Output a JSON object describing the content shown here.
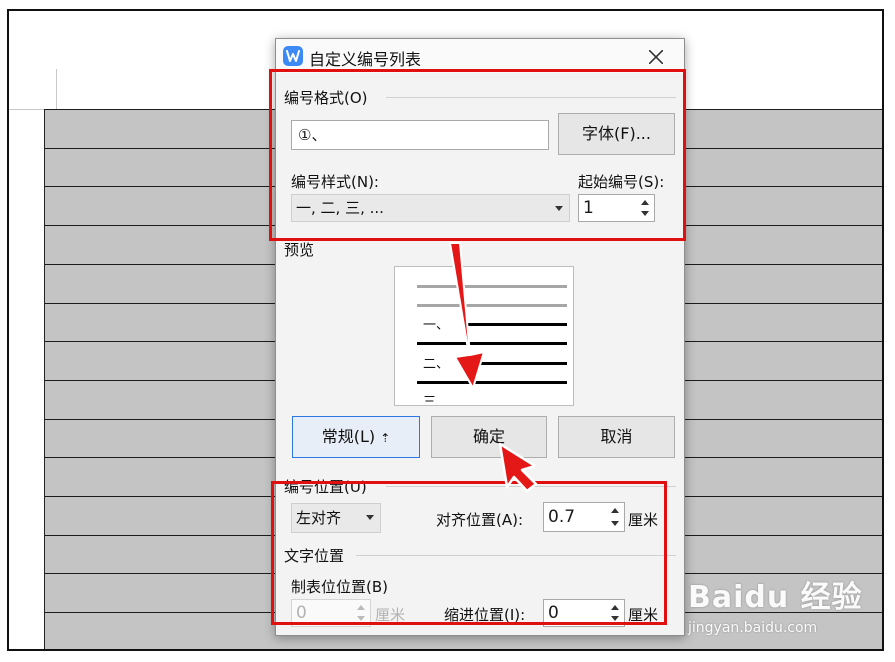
{
  "dialog": {
    "title": "自定义编号列表",
    "number_format": {
      "group_label": "编号格式(O)",
      "format_value": "①、",
      "font_button": "字体(F)...",
      "style_label": "编号样式(N):",
      "style_value": "一, 二, 三, ...",
      "start_label": "起始编号(S):",
      "start_value": "1"
    },
    "preview": {
      "label": "预览",
      "items": [
        "一、",
        "二、",
        "三"
      ]
    },
    "buttons": {
      "normal": "常规(L)",
      "normal_marker": "⇡",
      "ok": "确定",
      "cancel": "取消"
    },
    "number_position": {
      "group_label": "编号位置(U)",
      "align_value": "左对齐",
      "align_pos_label": "对齐位置(A):",
      "align_pos_value": "0.7",
      "unit": "厘米"
    },
    "text_position": {
      "group_label": "文字位置",
      "tab_label": "制表位位置(B)",
      "tab_value": "0",
      "tab_unit": "厘米",
      "indent_label": "缩进位置(I):",
      "indent_value": "0",
      "indent_unit": "厘米"
    }
  },
  "watermark": {
    "brand": "Baidu 经验",
    "url": "jingyan.baidu.com"
  },
  "colors": {
    "highlight_red": "#e01010",
    "app_icon_blue": "#3d8af7",
    "table_gray": "#c4c4c4"
  }
}
